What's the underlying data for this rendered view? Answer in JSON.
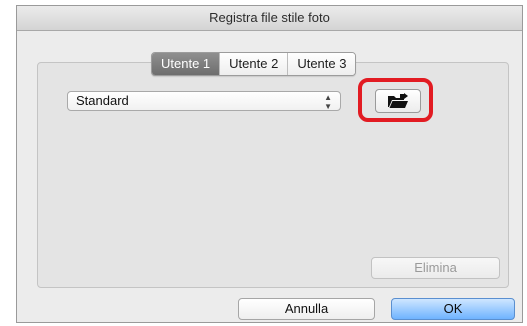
{
  "window": {
    "title": "Registra file stile foto"
  },
  "tabs": [
    {
      "label": "Utente 1",
      "active": true
    },
    {
      "label": "Utente 2",
      "active": false
    },
    {
      "label": "Utente 3",
      "active": false
    }
  ],
  "style_select": {
    "value": "Standard",
    "arrows_icon": "up-down-arrows-icon"
  },
  "open_file_button": {
    "icon": "folder-open-icon",
    "highlight_color": "#e21b22"
  },
  "delete_button": {
    "label": "Elimina",
    "enabled": false
  },
  "footer": {
    "cancel_label": "Annulla",
    "ok_label": "OK"
  },
  "colors": {
    "accent_default_button": "#6fb3ff",
    "highlight": "#e21b22"
  }
}
